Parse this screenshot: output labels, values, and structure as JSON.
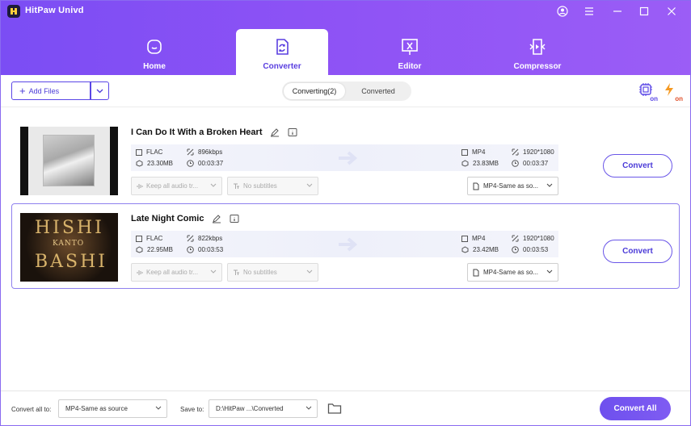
{
  "app": {
    "title": "HitPaw Univd"
  },
  "colors": {
    "accent": "#6b4ff0",
    "header_start": "#7b4df4",
    "header_end": "#9b5df6",
    "badge_orange": "#f59a23"
  },
  "nav": {
    "tabs": [
      {
        "label": "Home",
        "icon": "home-face-icon",
        "active": false
      },
      {
        "label": "Converter",
        "icon": "convert-file-icon",
        "active": true
      },
      {
        "label": "Editor",
        "icon": "editor-cut-icon",
        "active": false
      },
      {
        "label": "Compressor",
        "icon": "compress-icon",
        "active": false
      }
    ]
  },
  "toolbar": {
    "add_files_label": "Add Files",
    "tabs": [
      "Converting(2)",
      "Converted"
    ],
    "hw_badge": "on",
    "speed_badge": "on"
  },
  "files": [
    {
      "name": "I Can Do It With a Broken Heart",
      "src_format": "FLAC",
      "src_bitrate": "896kbps",
      "src_size": "23.30MB",
      "src_duration": "00:03:37",
      "dst_format": "MP4",
      "dst_resolution": "1920*1080",
      "dst_size": "23.83MB",
      "dst_duration": "00:03:37",
      "audio_track": "Keep all audio tr...",
      "subtitles": "No subtitles",
      "output_format": "MP4-Same as so...",
      "convert_label": "Convert"
    },
    {
      "name": "Late Night Comic",
      "src_format": "FLAC",
      "src_bitrate": "822kbps",
      "src_size": "22.95MB",
      "src_duration": "00:03:53",
      "dst_format": "MP4",
      "dst_resolution": "1920*1080",
      "dst_size": "23.42MB",
      "dst_duration": "00:03:53",
      "audio_track": "Keep all audio tr...",
      "subtitles": "No subtitles",
      "output_format": "MP4-Same as so...",
      "convert_label": "Convert",
      "cover_text_top": "HISHI",
      "cover_text_mid": "KANTO",
      "cover_text_bottom": "BASHI"
    }
  ],
  "footer": {
    "convert_all_to_label": "Convert all to:",
    "convert_all_to_value": "MP4-Same as source",
    "save_to_label": "Save to:",
    "save_to_value": "D:\\HitPaw ...\\Converted",
    "convert_all_label": "Convert All"
  }
}
